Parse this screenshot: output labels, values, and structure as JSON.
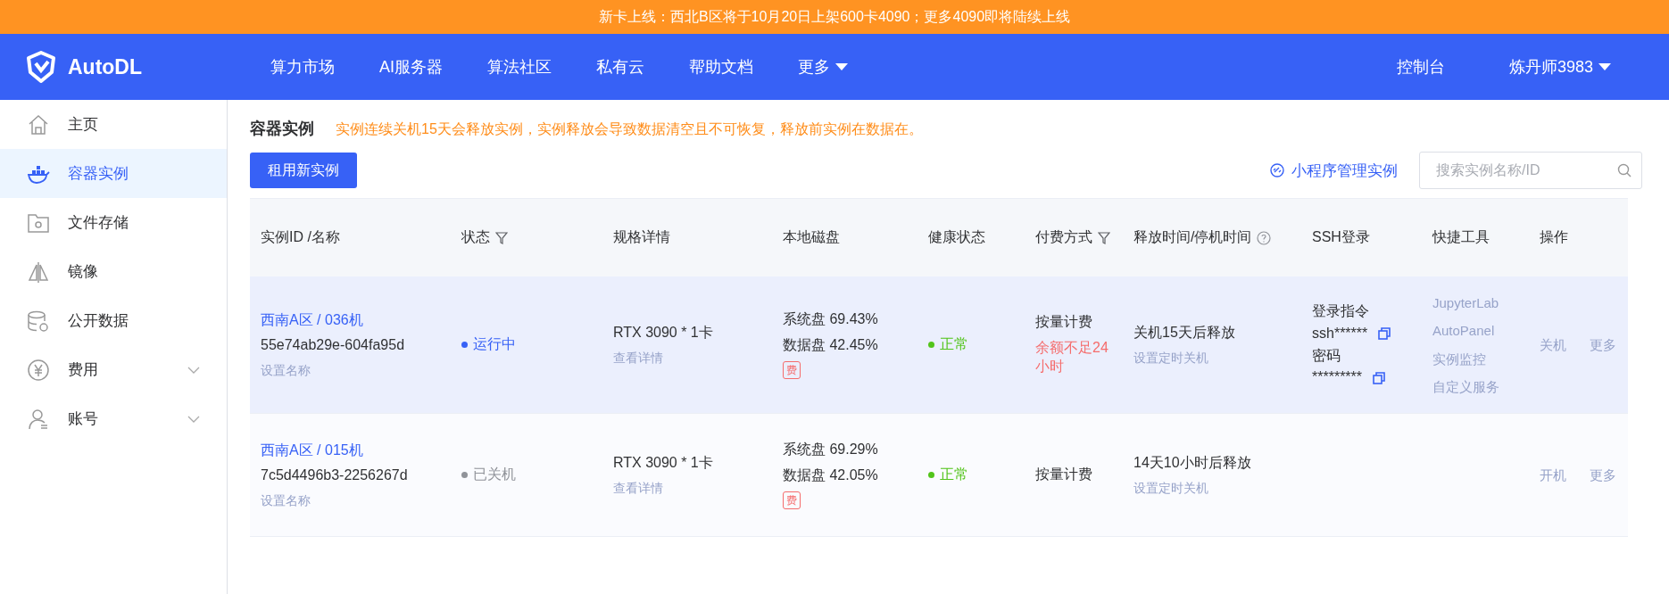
{
  "banner": {
    "text": "新卡上线：西北B区将于10月20日上架600卡4090；更多4090即将陆续上线"
  },
  "nav": {
    "logo": "AutoDL",
    "items": [
      {
        "label": "算力市场",
        "caret": false
      },
      {
        "label": "AI服务器",
        "caret": false
      },
      {
        "label": "算法社区",
        "caret": false
      },
      {
        "label": "私有云",
        "caret": false
      },
      {
        "label": "帮助文档",
        "caret": false
      },
      {
        "label": "更多",
        "caret": true
      }
    ],
    "right": [
      {
        "label": "控制台",
        "caret": false
      },
      {
        "label": "炼丹师3983",
        "caret": true
      }
    ]
  },
  "sidebar": {
    "items": [
      {
        "label": "主页",
        "kind": "home",
        "selected": false,
        "expandable": false
      },
      {
        "label": "容器实例",
        "kind": "whale",
        "selected": true,
        "expandable": false
      },
      {
        "label": "文件存储",
        "kind": "folder",
        "selected": false,
        "expandable": false
      },
      {
        "label": "镜像",
        "kind": "mirror",
        "selected": false,
        "expandable": false
      },
      {
        "label": "公开数据",
        "kind": "database",
        "selected": false,
        "expandable": false
      },
      {
        "label": "费用",
        "kind": "yen",
        "selected": false,
        "expandable": true
      },
      {
        "label": "账号",
        "kind": "user",
        "selected": false,
        "expandable": true
      }
    ]
  },
  "page": {
    "title": "容器实例",
    "notice": "实例连续关机15天会释放实例，实例释放会导致数据清空且不可恢复，释放前实例在数据在。",
    "rent_button": "租用新实例",
    "mini_link": "小程序管理实例",
    "search": {
      "placeholder": "搜索实例名称/ID"
    }
  },
  "table": {
    "columns": [
      {
        "label": "实例ID /名称",
        "kind": "plain"
      },
      {
        "label": "状态",
        "kind": "filter"
      },
      {
        "label": "规格详情",
        "kind": "plain"
      },
      {
        "label": "本地磁盘",
        "kind": "plain"
      },
      {
        "label": "健康状态",
        "kind": "plain"
      },
      {
        "label": "付费方式",
        "kind": "filter"
      },
      {
        "label": "释放时间/停机时间",
        "kind": "help"
      },
      {
        "label": "SSH登录",
        "kind": "plain"
      },
      {
        "label": "快捷工具",
        "kind": "plain"
      },
      {
        "label": "操作",
        "kind": "plain"
      }
    ],
    "rows": [
      {
        "highlighted": true,
        "name": "西南A区 / 036机",
        "id": "55e74ab29e-604fa95d",
        "set_name": "设置名称",
        "status": {
          "label": "运行中",
          "kind": "running"
        },
        "spec": "RTX 3090 * 1卡",
        "spec_link": "查看详情",
        "disks": [
          "系统盘 69.43%",
          "数据盘 42.45%"
        ],
        "fee_tag": "费",
        "health": "正常",
        "payment": "按量计费",
        "payment_warning": "余额不足24小时",
        "release": "关机15天后释放",
        "release_link": "设置定时关机",
        "ssh": {
          "command_label": "登录指令",
          "command": "ssh******",
          "password_label": "密码",
          "password": "*********"
        },
        "tools": [
          "JupyterLab",
          "AutoPanel",
          "实例监控",
          "自定义服务"
        ],
        "actions": [
          "关机",
          "更多"
        ]
      },
      {
        "highlighted": false,
        "name": "西南A区 / 015机",
        "id": "7c5d4496b3-2256267d",
        "set_name": "设置名称",
        "status": {
          "label": "已关机",
          "kind": "stopped"
        },
        "spec": "RTX 3090 * 1卡",
        "spec_link": "查看详情",
        "disks": [
          "系统盘 69.29%",
          "数据盘 42.05%"
        ],
        "fee_tag": "费",
        "health": "正常",
        "payment": "按量计费",
        "release": "14天10小时后释放",
        "release_link": "设置定时关机",
        "actions": [
          "开机",
          "更多"
        ]
      }
    ]
  }
}
